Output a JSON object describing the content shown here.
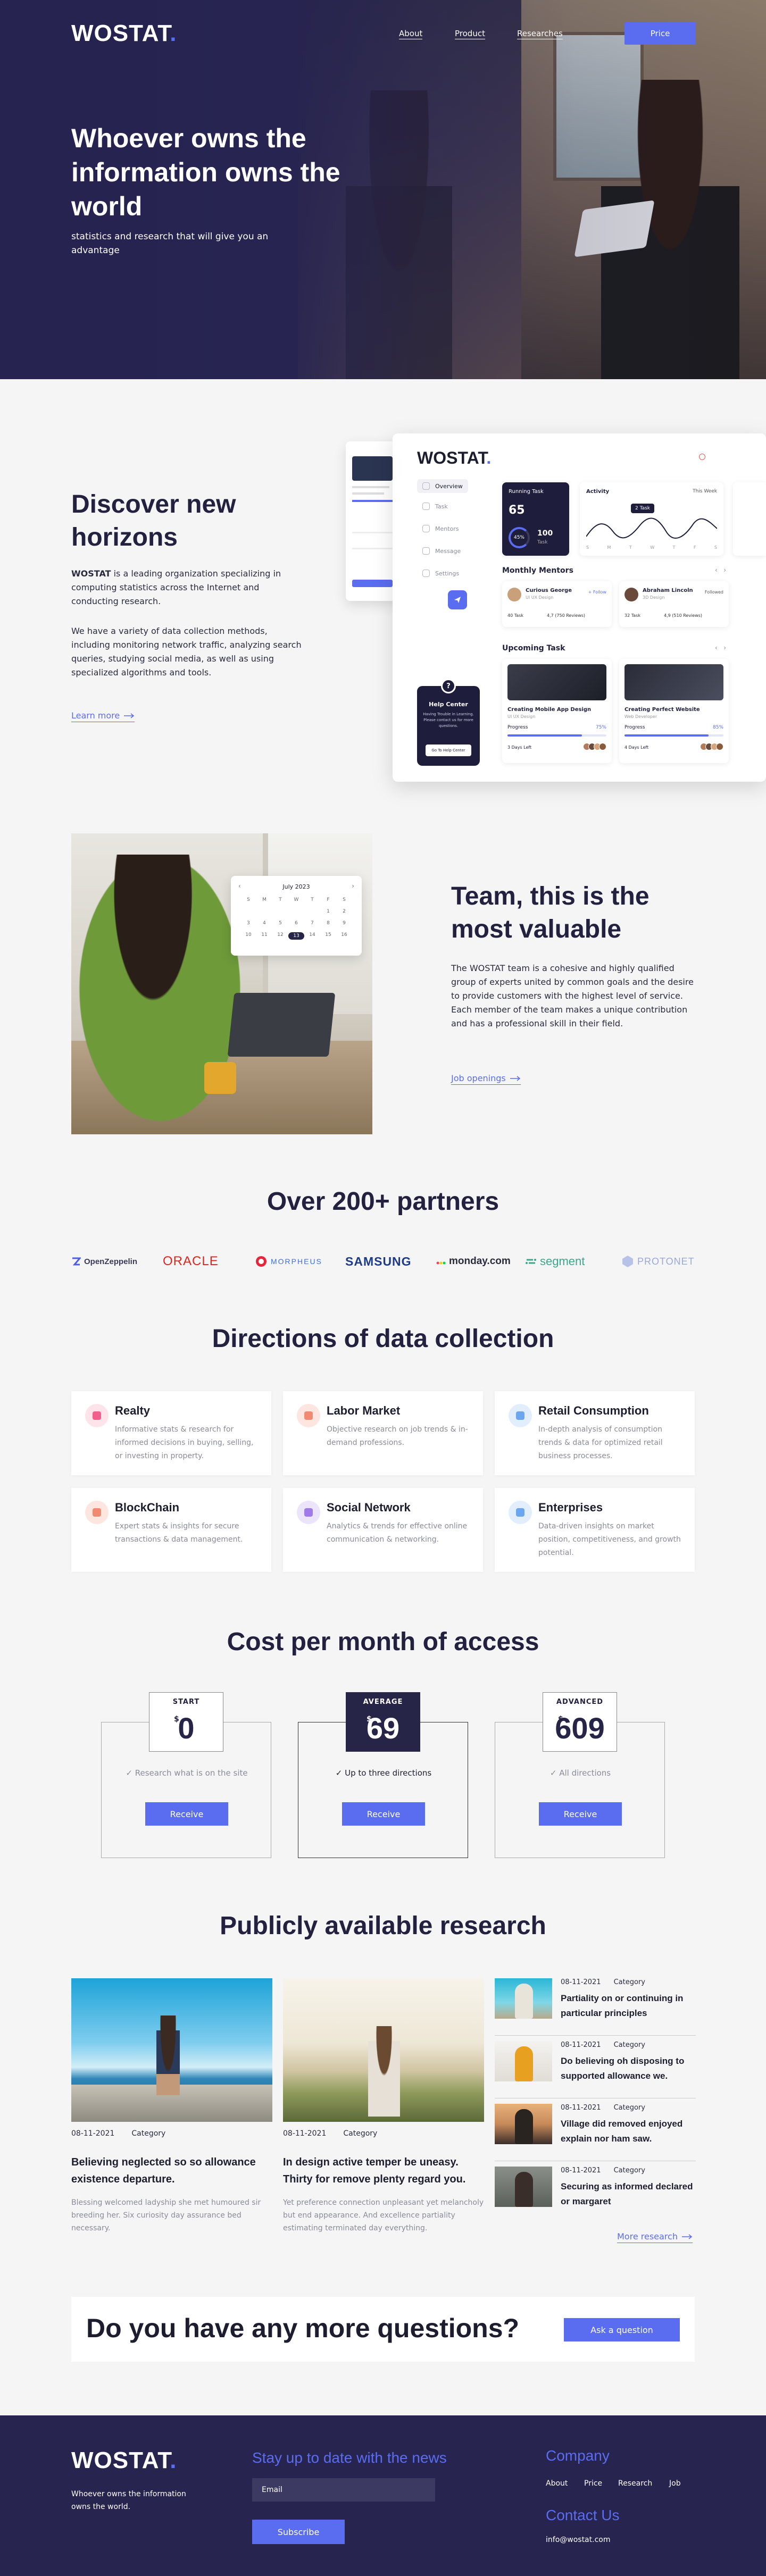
{
  "brand": {
    "name": "WOSTAT",
    "dot": ".",
    "accent": "#5a6df0",
    "dark": "#27244f"
  },
  "nav": {
    "about": "About",
    "product": "Product",
    "researches": "Researches",
    "price": "Price"
  },
  "hero": {
    "title": "Whoever owns the information owns the world",
    "subtitle": "statistics and research that will give you an advantage"
  },
  "discover": {
    "title": "Discover new horizons",
    "p1_strong": "WOSTAT",
    "p1": " is a leading organization specializing in computing statistics across the Internet and conducting research.",
    "p2": "We have a variety of data collection methods, including monitoring network traffic, analyzing search queries, studying social media, as well as using specialized algorithms and tools.",
    "link": "Learn more"
  },
  "dashboard": {
    "logo": "WOSTAT",
    "sidebar": [
      "Overview",
      "Task",
      "Mentors",
      "Message",
      "Settings"
    ],
    "running_task": {
      "label": "Running Task",
      "value": "65",
      "percent": "45%",
      "total": "100",
      "total_label": "Task"
    },
    "activity": {
      "label": "Activity",
      "range": "This Week",
      "badge": "2 Task",
      "days": [
        "S",
        "M",
        "T",
        "W",
        "T",
        "F",
        "S"
      ]
    },
    "monthly_mentors": "Monthly Mentors",
    "mentors": [
      {
        "name": "Curious George",
        "role": "UI UX Design",
        "action": "+ Follow",
        "tasks": "40 Task",
        "rating": "4,7 (750 Reviews)"
      },
      {
        "name": "Abraham Lincoln",
        "role": "3D Design",
        "action": "Followed",
        "tasks": "32 Task",
        "rating": "4,9 (510 Reviews)"
      }
    ],
    "upcoming": "Upcoming Task",
    "tasks": [
      {
        "title": "Creating Mobile App Design",
        "sub": "UI UX Design",
        "progress_label": "Progress",
        "progress": "75%",
        "left": "3 Days Left"
      },
      {
        "title": "Creating Perfect Website",
        "sub": "Web Developer",
        "progress_label": "Progress",
        "progress": "85%",
        "left": "4 Days Left"
      }
    ],
    "help": {
      "title": "Help Center",
      "text": "Having Trouble in Learning. Please contact us for more questions.",
      "button": "Go To Help Center",
      "mark": "?"
    }
  },
  "team": {
    "title": "Team, this is the most valuable",
    "text": "The WOSTAT team is a cohesive and highly qualified group of experts united by common goals and the desire to provide customers with the highest level of service. Each member of the team makes a unique contribution and has a professional skill in their field.",
    "link": "Job openings",
    "calendar": {
      "month": "July 2023",
      "days": [
        "S",
        "M",
        "T",
        "W",
        "T",
        "F",
        "S"
      ],
      "dates": [
        "",
        "",
        "",
        "",
        "",
        "1",
        "2",
        "3",
        "4",
        "5",
        "6",
        "7",
        "8",
        "9",
        "10",
        "11",
        "12",
        "13",
        "14",
        "15",
        "16"
      ]
    }
  },
  "partners": {
    "title": "Over 200+ partners",
    "items": [
      "OpenZeppelin",
      "ORACLE",
      "MORPHEUS",
      "SAMSUNG",
      "monday.com",
      "segment",
      "PROTONET"
    ]
  },
  "directions": {
    "title": "Directions of data collection",
    "items": [
      {
        "title": "Realty",
        "text": "Informative stats & research for informed decisions in buying, selling, or investing in property.",
        "color": "#f0608a",
        "bg": "#fde3ea"
      },
      {
        "title": "Labor Market",
        "text": "Objective research on job trends & in-demand professions.",
        "color": "#f08a70",
        "bg": "#fde6df"
      },
      {
        "title": "Retail Consumption",
        "text": "In-depth analysis of consumption trends & data for optimized retail business processes.",
        "color": "#6aa7f0",
        "bg": "#e2eefc"
      },
      {
        "title": "BlockChain",
        "text": "Expert stats & insights for secure transactions & data management.",
        "color": "#f08a70",
        "bg": "#fde6df"
      },
      {
        "title": "Social Network",
        "text": "Analytics & trends for effective online communication & networking.",
        "color": "#a07ae8",
        "bg": "#ece4fb"
      },
      {
        "title": "Enterprises",
        "text": "Data-driven insights on market position, competitiveness, and growth potential.",
        "color": "#6aa7f0",
        "bg": "#e2eefc"
      }
    ]
  },
  "pricing": {
    "title": "Cost per month of access",
    "currency": "$",
    "button": "Receive",
    "plans": [
      {
        "label": "START",
        "price": "0",
        "feature": "Research what is on the site"
      },
      {
        "label": "AVERAGE",
        "price": "69",
        "feature": "Up to three directions"
      },
      {
        "label": "ADVANCED",
        "price": "609",
        "feature": "All directions"
      }
    ]
  },
  "research": {
    "title": "Publicly available research",
    "featured": [
      {
        "date": "08-11-2021",
        "category": "Category",
        "title": "Believing neglected so so allowance existence departure.",
        "desc": "Blessing welcomed ladyship she met humoured sir breeding her. Six curiosity day assurance bed necessary."
      },
      {
        "date": "08-11-2021",
        "category": "Category",
        "title": "In design active temper be uneasy. Thirty for remove plenty regard you.",
        "desc": "Yet preference connection unpleasant yet melancholy but end appearance. And excellence partiality estimating terminated day everything."
      }
    ],
    "list": [
      {
        "date": "08-11-2021",
        "category": "Category",
        "title": "Partiality on or continuing in particular principles"
      },
      {
        "date": "08-11-2021",
        "category": "Category",
        "title": "Do believing oh disposing to supported allowance we."
      },
      {
        "date": "08-11-2021",
        "category": "Category",
        "title": "Village did removed enjoyed explain nor ham saw."
      },
      {
        "date": "08-11-2021",
        "category": "Category",
        "title": "Securing as informed declared or margaret"
      }
    ],
    "more": "More research"
  },
  "questions": {
    "title": "Do you have any more questions?",
    "button": "Ask a question"
  },
  "footer": {
    "logo": "WOSTAT",
    "tagline": "Whoever owns the information owns the world.",
    "news_title": "Stay up to date with the news",
    "email_placeholder": "Email",
    "subscribe": "Subscribe",
    "company_title": "Company",
    "links": [
      "About",
      "Price",
      "Research",
      "Job"
    ],
    "contact_title": "Contact Us",
    "email": "info@wostat.com"
  }
}
